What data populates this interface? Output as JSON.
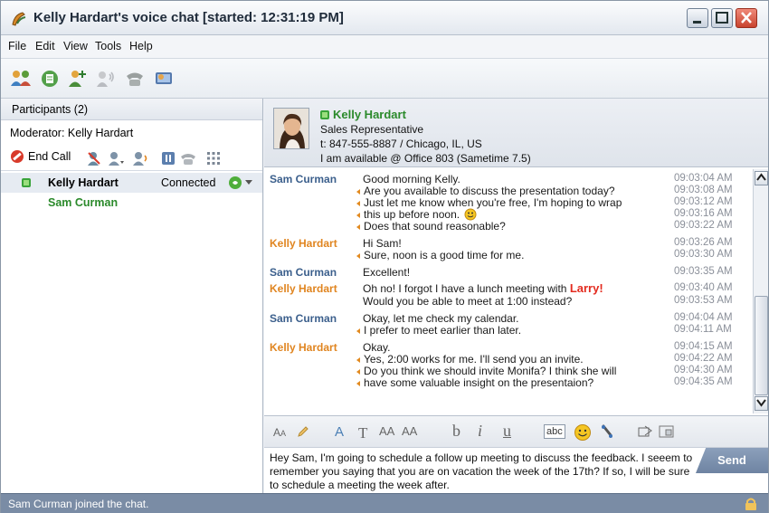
{
  "window": {
    "title": "Kelly Hardart's voice chat [started: 12:31:19 PM]"
  },
  "menu": [
    "File",
    "Edit",
    "View",
    "Tools",
    "Help"
  ],
  "toolbar_icons": [
    "participants-icon",
    "notes-icon",
    "add-contact-icon",
    "voice-icon",
    "phone-icon",
    "screen-share-icon"
  ],
  "participants": {
    "header": "Participants (2)",
    "moderator": "Moderator: Kelly Hardart",
    "end_call": "End Call",
    "list": [
      {
        "name": "Kelly Hardart",
        "status": "Connected",
        "color": "#111111"
      },
      {
        "name": "Sam Curman",
        "status": "",
        "color": "#2b8a2b"
      }
    ]
  },
  "contact": {
    "name": "Kelly Hardart",
    "title": "Sales Representative",
    "phone": "t: 847-555-8887 / Chicago, IL, US",
    "status": "I am available @ Office 803 (Sametime 7.5)"
  },
  "transcript": [
    {
      "sender": "Sam Curman",
      "who": "sam",
      "lines": [
        {
          "text": "Good morning Kelly.",
          "time": "09:03:04 AM"
        },
        {
          "text": "Are you available to discuss the presentation today?",
          "time": "09:03:08 AM"
        },
        {
          "text": "Just let me know when you're free, I'm hoping to wrap",
          "time": "09:03:12 AM"
        },
        {
          "text": "this up before noon.",
          "time": "09:03:16 AM"
        },
        {
          "text": "Does that sound reasonable?",
          "time": "09:03:22 AM"
        }
      ]
    },
    {
      "sender": "Kelly Hardart",
      "who": "kelly",
      "lines": [
        {
          "text": "Hi Sam!",
          "time": "09:03:26 AM"
        },
        {
          "text": "Sure, noon is a good time for me.",
          "time": "09:03:30 AM"
        }
      ]
    },
    {
      "sender": "Sam Curman",
      "who": "sam",
      "lines": [
        {
          "text": "Excellent!",
          "time": "09:03:35 AM"
        }
      ]
    },
    {
      "sender": "Kelly Hardart",
      "who": "kelly",
      "lines": [
        {
          "text": "Oh no! I forgot I have a lunch meeting with",
          "highlight": "Larry!",
          "time": "09:03:40 AM"
        },
        {
          "text": "Would you be able to meet at 1:00 instead?",
          "time": "09:03:53 AM"
        }
      ]
    },
    {
      "sender": "Sam Curman",
      "who": "sam",
      "lines": [
        {
          "text": "Okay, let me check my calendar.",
          "time": "09:04:04 AM"
        },
        {
          "text": "I prefer to meet earlier than later.",
          "time": "09:04:11 AM"
        }
      ]
    },
    {
      "sender": "Kelly Hardart",
      "who": "kelly",
      "lines": [
        {
          "text": "Okay.",
          "time": "09:04:15 AM"
        },
        {
          "text": "Yes, 2:00 works for me. I'll send you an invite.",
          "time": "09:04:22 AM"
        },
        {
          "text": "Do you think we should invite Monifa? I think she will",
          "time": "09:04:30 AM"
        },
        {
          "text": "have some valuable insight on the presentaion?",
          "time": "09:04:35 AM"
        }
      ]
    }
  ],
  "format_toolbar": {
    "font_size_label": "A",
    "text_large": "T",
    "grow": "AA",
    "shrink": "AA",
    "bold": "b",
    "italic": "i",
    "underline": "u",
    "spellcheck": "abc"
  },
  "input": {
    "text": "Hey Sam, I'm going to schedule a follow up meeting to discuss the feedback. I seeem to remember you saying that you are on vacation the week of the 17th? If so, I will be sure to schedule a meeting the week after.",
    "send_label": "Send"
  },
  "status_bar": "Sam Curman joined the chat."
}
